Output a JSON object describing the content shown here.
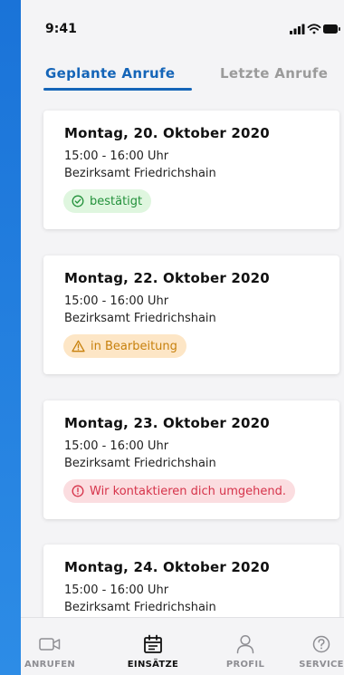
{
  "status_bar": {
    "time": "9:41"
  },
  "tabs": [
    {
      "label": "Geplante Anrufe",
      "active": true
    },
    {
      "label": "Letzte Anrufe",
      "active": false
    }
  ],
  "appointments": [
    {
      "date": "Montag, 20. Oktober 2020",
      "time": "15:00 - 16:00 Uhr",
      "place": "Bezirksamt Friedrichshain",
      "status": "bestätigt",
      "status_type": "confirmed",
      "status_color": "#23913b"
    },
    {
      "date": "Montag, 22. Oktober 2020",
      "time": "15:00 - 16:00 Uhr",
      "place": "Bezirksamt Friedrichshain",
      "status": "in Bearbeitung",
      "status_type": "processing",
      "status_color": "#c7800c"
    },
    {
      "date": "Montag, 23. Oktober 2020",
      "time": "15:00 - 16:00 Uhr",
      "place": "Bezirksamt Friedrichshain",
      "status": "Wir kontaktieren dich umgehend.",
      "status_type": "contact",
      "status_color": "#d6334a"
    },
    {
      "date": "Montag, 24. Oktober 2020",
      "time": "15:00 - 16:00 Uhr",
      "place": "Bezirksamt Friedrichshain"
    }
  ],
  "bottom_nav": [
    {
      "label": "ANRUFEN",
      "icon": "video-camera-icon",
      "active": false
    },
    {
      "label": "EINSÄTZE",
      "icon": "calendar-icon",
      "active": true
    },
    {
      "label": "PROFIL",
      "icon": "person-icon",
      "active": false
    },
    {
      "label": "SERVICE",
      "icon": "help-circle-icon",
      "active": false
    }
  ],
  "colors": {
    "accent": "#1565b8",
    "background": "#f4f4f6"
  }
}
